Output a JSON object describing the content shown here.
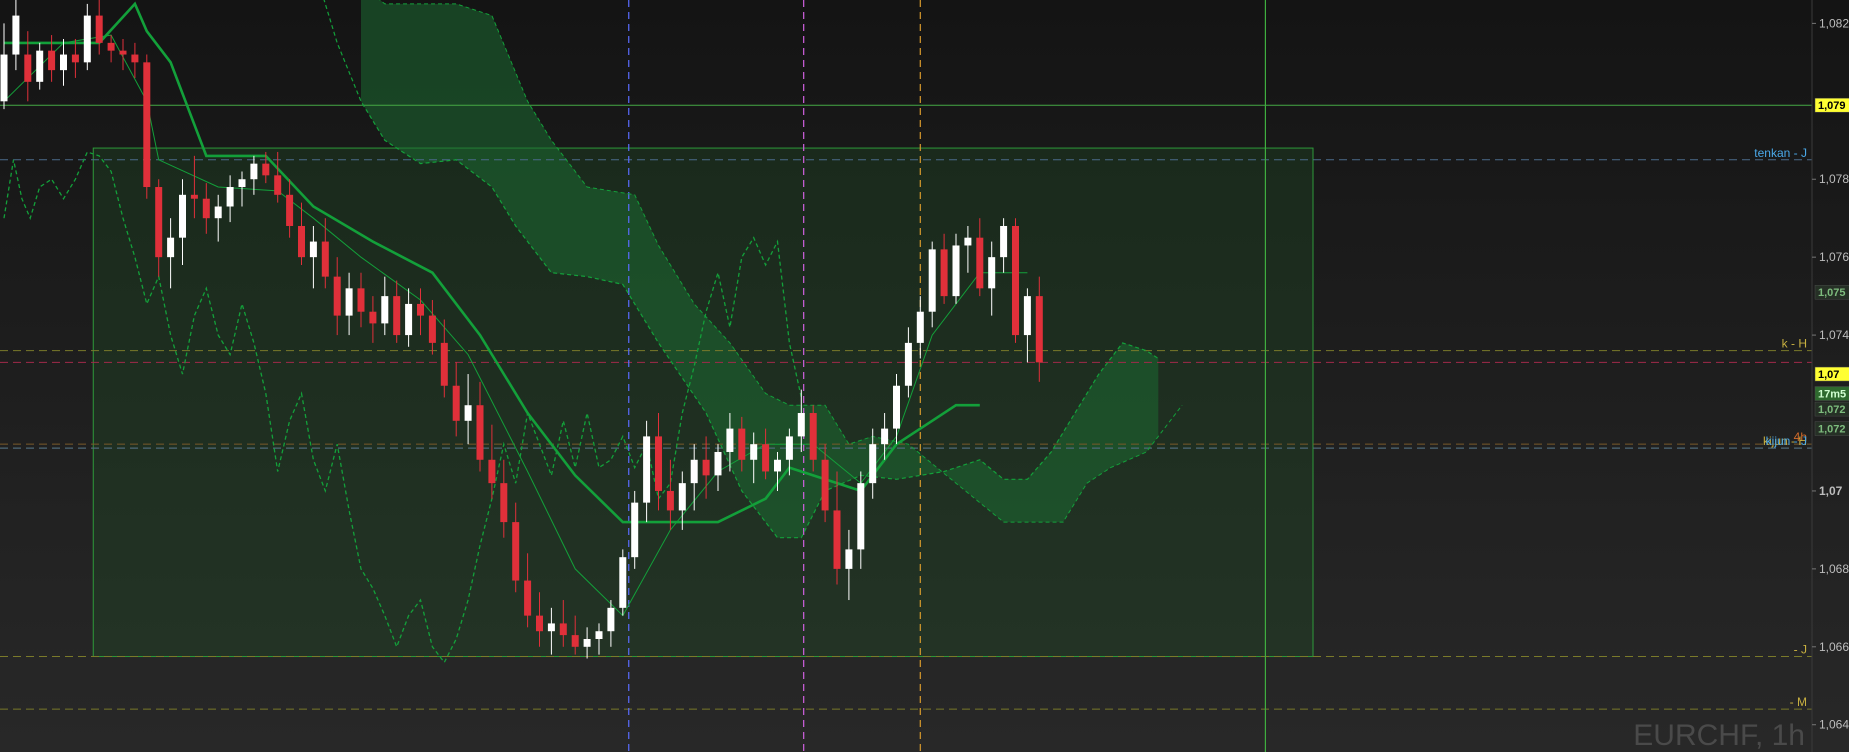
{
  "chart_data": {
    "type": "candlestick",
    "symbol": "EURCHF, 1h",
    "colors": {
      "background_top": "#161616",
      "background_bottom": "#262626",
      "up": "#ffffff",
      "down": "#e0303a",
      "ichimoku": "#13a03a",
      "kumo_fill": "#1c6a32",
      "range_box_fill": "#1f4d26",
      "range_box_stroke": "#2e9a3a",
      "vline_blue": "#5a6cff",
      "vline_magenta": "#d060e0",
      "vline_orange": "#d79a2c",
      "vline_green": "#3fae3f"
    },
    "y_axis": {
      "range": [
        1.0633,
        1.0826
      ],
      "ticks": [
        {
          "value": 1.082,
          "label": "1,082"
        },
        {
          "value": 1.078,
          "label": "1,078"
        },
        {
          "value": 1.076,
          "label": "1,076"
        },
        {
          "value": 1.074,
          "label": "1,074"
        },
        {
          "value": 1.07,
          "label": "1,07"
        },
        {
          "value": 1.068,
          "label": "1,068"
        },
        {
          "value": 1.066,
          "label": "1,066"
        },
        {
          "value": 1.064,
          "label": "1,064"
        }
      ],
      "price_tags": [
        {
          "value": 1.0799,
          "label": "1,079",
          "bg": "#ffff33",
          "fg": "#000000"
        },
        {
          "value": 1.073,
          "label": "1,07",
          "bg": "#ffff33",
          "fg": "#000000"
        },
        {
          "value": 1.0725,
          "label": "17m5",
          "bg": "#2e6a2e",
          "fg": "#d0ffd0"
        },
        {
          "value": 1.0751,
          "label": "1,075",
          "bg": "#263026",
          "fg": "#7dbb7d"
        },
        {
          "value": 1.0721,
          "label": "1,072",
          "bg": "#263026",
          "fg": "#7dbb7d"
        },
        {
          "value": 1.0716,
          "label": "1,072",
          "bg": "#263026",
          "fg": "#7dbb7d"
        }
      ]
    },
    "horizontal_lines": [
      {
        "value": 1.0799,
        "color": "#45a845",
        "style": "solid",
        "label": ""
      },
      {
        "value": 1.0785,
        "color": "#4a6a8a",
        "style": "dashed",
        "label": "tenkan - J",
        "label_color": "#4aa8e8"
      },
      {
        "value": 1.0736,
        "color": "#7a7a2a",
        "style": "dashed",
        "label": "k - H",
        "label_color": "#c8b040"
      },
      {
        "value": 1.0733,
        "color": "#a02a4a",
        "style": "dashed",
        "label": ""
      },
      {
        "value": 1.0712,
        "color": "#7a5a2a",
        "style": "dashed",
        "label": "4h",
        "label_color": "#d06a2a"
      },
      {
        "value": 1.0711,
        "color": "#7a7a2a",
        "style": "dashed",
        "label": "kijun - H",
        "label_color": "#c8b040"
      },
      {
        "value": 1.0711,
        "color": "#4a6a8a",
        "style": "dashed",
        "label": "kijun - J",
        "label_color": "#4aa8e8"
      },
      {
        "value": 1.06575,
        "color": "#7a7a2a",
        "style": "dashed",
        "label": "- J",
        "label_color": "#c8b040"
      },
      {
        "value": 1.0644,
        "color": "#7a7a2a",
        "style": "dashed",
        "label": "- M",
        "label_color": "#c8b040"
      }
    ],
    "range_box": {
      "x_start": 7.5,
      "x_end": 110.0,
      "y_top": 1.0788,
      "y_bottom": 1.06575
    },
    "vertical_lines": [
      {
        "x": 52.5,
        "color_key": "vline_blue"
      },
      {
        "x": 67.2,
        "color_key": "vline_magenta"
      },
      {
        "x": 77.0,
        "color_key": "vline_orange"
      },
      {
        "x": 106.0,
        "color_key": "vline_green"
      }
    ],
    "candles": [
      [
        1.08,
        1.082,
        1.0798,
        1.0812
      ],
      [
        1.0812,
        1.0826,
        1.0808,
        1.0822
      ],
      [
        1.0812,
        1.0818,
        1.08,
        1.0805
      ],
      [
        1.0805,
        1.0815,
        1.0803,
        1.0813
      ],
      [
        1.0813,
        1.0817,
        1.0805,
        1.0808
      ],
      [
        1.0808,
        1.0816,
        1.0804,
        1.0812
      ],
      [
        1.0812,
        1.0816,
        1.0806,
        1.081
      ],
      [
        1.081,
        1.0825,
        1.0808,
        1.0822
      ],
      [
        1.0822,
        1.0826,
        1.0812,
        1.0815
      ],
      [
        1.0815,
        1.0817,
        1.081,
        1.0813
      ],
      [
        1.0813,
        1.0816,
        1.0808,
        1.0812
      ],
      [
        1.0812,
        1.0815,
        1.0806,
        1.081
      ],
      [
        1.081,
        1.0812,
        1.0775,
        1.0778
      ],
      [
        1.0778,
        1.078,
        1.0755,
        1.076
      ],
      [
        1.076,
        1.077,
        1.0752,
        1.0765
      ],
      [
        1.0765,
        1.078,
        1.0758,
        1.0776
      ],
      [
        1.0776,
        1.0786,
        1.077,
        1.0775
      ],
      [
        1.0775,
        1.0779,
        1.0766,
        1.077
      ],
      [
        1.077,
        1.0776,
        1.0764,
        1.0773
      ],
      [
        1.0773,
        1.0781,
        1.0769,
        1.0778
      ],
      [
        1.0778,
        1.0782,
        1.0773,
        1.078
      ],
      [
        1.078,
        1.0786,
        1.0776,
        1.0784
      ],
      [
        1.0784,
        1.0787,
        1.0779,
        1.0781
      ],
      [
        1.0781,
        1.0787,
        1.0774,
        1.0776
      ],
      [
        1.0776,
        1.078,
        1.0765,
        1.0768
      ],
      [
        1.0768,
        1.0774,
        1.0758,
        1.076
      ],
      [
        1.076,
        1.0768,
        1.0752,
        1.0764
      ],
      [
        1.0764,
        1.077,
        1.0752,
        1.0755
      ],
      [
        1.0755,
        1.076,
        1.074,
        1.0745
      ],
      [
        1.0745,
        1.0756,
        1.074,
        1.0752
      ],
      [
        1.0752,
        1.0756,
        1.0742,
        1.0746
      ],
      [
        1.0746,
        1.075,
        1.0738,
        1.0743
      ],
      [
        1.0743,
        1.0755,
        1.074,
        1.075
      ],
      [
        1.075,
        1.0754,
        1.0738,
        1.074
      ],
      [
        1.074,
        1.0752,
        1.0737,
        1.0748
      ],
      [
        1.0748,
        1.0752,
        1.074,
        1.0745
      ],
      [
        1.0745,
        1.0749,
        1.0735,
        1.0738
      ],
      [
        1.0738,
        1.0744,
        1.0724,
        1.0727
      ],
      [
        1.0727,
        1.0733,
        1.0714,
        1.0718
      ],
      [
        1.0718,
        1.073,
        1.0712,
        1.0722
      ],
      [
        1.0722,
        1.0728,
        1.0705,
        1.0708
      ],
      [
        1.0708,
        1.0717,
        1.0698,
        1.0702
      ],
      [
        1.0702,
        1.0708,
        1.0688,
        1.0692
      ],
      [
        1.0692,
        1.0697,
        1.0674,
        1.0677
      ],
      [
        1.0677,
        1.0684,
        1.0665,
        1.0668
      ],
      [
        1.0668,
        1.0674,
        1.066,
        1.0664
      ],
      [
        1.0664,
        1.067,
        1.0658,
        1.0666
      ],
      [
        1.0666,
        1.0672,
        1.066,
        1.0663
      ],
      [
        1.0663,
        1.0668,
        1.0658,
        1.066
      ],
      [
        1.066,
        1.0665,
        1.0657,
        1.0662
      ],
      [
        1.0662,
        1.0666,
        1.0658,
        1.0664
      ],
      [
        1.0664,
        1.0672,
        1.066,
        1.067
      ],
      [
        1.067,
        1.0685,
        1.0668,
        1.0683
      ],
      [
        1.0683,
        1.07,
        1.068,
        1.0697
      ],
      [
        1.0697,
        1.0718,
        1.0692,
        1.0714
      ],
      [
        1.0714,
        1.072,
        1.0695,
        1.07
      ],
      [
        1.07,
        1.0708,
        1.069,
        1.0695
      ],
      [
        1.0695,
        1.0705,
        1.069,
        1.0702
      ],
      [
        1.0702,
        1.0712,
        1.0695,
        1.0708
      ],
      [
        1.0708,
        1.0714,
        1.0698,
        1.0704
      ],
      [
        1.0704,
        1.0712,
        1.07,
        1.071
      ],
      [
        1.071,
        1.072,
        1.0705,
        1.0716
      ],
      [
        1.0716,
        1.0719,
        1.0705,
        1.0708
      ],
      [
        1.0708,
        1.0715,
        1.0702,
        1.0712
      ],
      [
        1.0712,
        1.0716,
        1.0703,
        1.0705
      ],
      [
        1.0705,
        1.071,
        1.07,
        1.0708
      ],
      [
        1.0708,
        1.0716,
        1.0704,
        1.0714
      ],
      [
        1.0714,
        1.0726,
        1.071,
        1.072
      ],
      [
        1.072,
        1.0722,
        1.0705,
        1.0708
      ],
      [
        1.0708,
        1.0712,
        1.0692,
        1.0695
      ],
      [
        1.0695,
        1.0705,
        1.0676,
        1.068
      ],
      [
        1.068,
        1.069,
        1.0672,
        1.0685
      ],
      [
        1.0685,
        1.0705,
        1.068,
        1.0702
      ],
      [
        1.0702,
        1.0716,
        1.0698,
        1.0712
      ],
      [
        1.0712,
        1.072,
        1.0708,
        1.0716
      ],
      [
        1.0716,
        1.073,
        1.0712,
        1.0727
      ],
      [
        1.0727,
        1.0742,
        1.0724,
        1.0738
      ],
      [
        1.0738,
        1.075,
        1.0734,
        1.0746
      ],
      [
        1.0746,
        1.0764,
        1.0742,
        1.0762
      ],
      [
        1.0762,
        1.0766,
        1.0748,
        1.075
      ],
      [
        1.075,
        1.0766,
        1.0748,
        1.0763
      ],
      [
        1.0763,
        1.0768,
        1.0756,
        1.0765
      ],
      [
        1.0765,
        1.077,
        1.075,
        1.0752
      ],
      [
        1.0752,
        1.0764,
        1.0745,
        1.076
      ],
      [
        1.076,
        1.077,
        1.0756,
        1.0768
      ],
      [
        1.0768,
        1.077,
        1.0738,
        1.074
      ],
      [
        1.074,
        1.0752,
        1.0733,
        1.075
      ],
      [
        1.075,
        1.0755,
        1.0728,
        1.0733
      ]
    ],
    "tenkan": [
      [
        0,
        1.08
      ],
      [
        5,
        1.0815
      ],
      [
        9,
        1.0817
      ],
      [
        12,
        1.08
      ],
      [
        13,
        1.0785
      ],
      [
        18,
        1.0778
      ],
      [
        23,
        1.0777
      ],
      [
        26,
        1.077
      ],
      [
        30,
        1.076
      ],
      [
        35,
        1.0749
      ],
      [
        39,
        1.0735
      ],
      [
        44,
        1.0705
      ],
      [
        48,
        1.068
      ],
      [
        52,
        1.0668
      ],
      [
        56,
        1.069
      ],
      [
        60,
        1.0705
      ],
      [
        64,
        1.0712
      ],
      [
        68,
        1.0712
      ],
      [
        72,
        1.0702
      ],
      [
        75,
        1.0714
      ],
      [
        78,
        1.074
      ],
      [
        82,
        1.0756
      ],
      [
        86,
        1.0756
      ]
    ],
    "kijun": [
      [
        0,
        1.0815
      ],
      [
        4,
        1.0815
      ],
      [
        8,
        1.0815
      ],
      [
        11,
        1.0825
      ],
      [
        12,
        1.0818
      ],
      [
        14,
        1.081
      ],
      [
        17,
        1.0786
      ],
      [
        22,
        1.0786
      ],
      [
        26,
        1.0773
      ],
      [
        31,
        1.0764
      ],
      [
        36,
        1.0756
      ],
      [
        40,
        1.074
      ],
      [
        44,
        1.072
      ],
      [
        48,
        1.0704
      ],
      [
        52,
        1.0692
      ],
      [
        56,
        1.0692
      ],
      [
        60,
        1.0692
      ],
      [
        64,
        1.0698
      ],
      [
        66,
        1.0706
      ],
      [
        68,
        1.0704
      ],
      [
        72,
        1.07
      ],
      [
        75,
        1.0712
      ],
      [
        78,
        1.0718
      ],
      [
        80,
        1.0722
      ],
      [
        82,
        1.0722
      ]
    ],
    "senkou_a": [
      [
        30,
        1.083
      ],
      [
        32,
        1.0825
      ],
      [
        38,
        1.0825
      ],
      [
        41,
        1.0822
      ],
      [
        44,
        1.08
      ],
      [
        46,
        1.079
      ],
      [
        49,
        1.0778
      ],
      [
        53,
        1.0776
      ],
      [
        55,
        1.0763
      ],
      [
        58,
        1.0748
      ],
      [
        61,
        1.0738
      ],
      [
        64,
        1.0725
      ],
      [
        66,
        1.0722
      ],
      [
        69,
        1.0722
      ],
      [
        71,
        1.0712
      ],
      [
        73,
        1.0714
      ],
      [
        76,
        1.0712
      ],
      [
        80,
        1.0702
      ],
      [
        84,
        1.0692
      ],
      [
        87,
        1.0692
      ],
      [
        89,
        1.0692
      ],
      [
        91,
        1.0702
      ],
      [
        93,
        1.0706
      ],
      [
        96,
        1.071
      ],
      [
        98,
        1.0718
      ],
      [
        99,
        1.0722
      ]
    ],
    "senkou_b": [
      [
        26,
        1.0835
      ],
      [
        28,
        1.0815
      ],
      [
        30,
        1.08
      ],
      [
        32,
        1.079
      ],
      [
        35,
        1.0784
      ],
      [
        38,
        1.0785
      ],
      [
        41,
        1.0778
      ],
      [
        43,
        1.0768
      ],
      [
        46,
        1.0756
      ],
      [
        49,
        1.0755
      ],
      [
        52,
        1.0753
      ],
      [
        55,
        1.0738
      ],
      [
        59,
        1.072
      ],
      [
        62,
        1.07
      ],
      [
        65,
        1.0688
      ],
      [
        67,
        1.0688
      ],
      [
        69,
        1.07
      ],
      [
        72,
        1.0704
      ],
      [
        75,
        1.0703
      ],
      [
        79,
        1.0705
      ],
      [
        82,
        1.0708
      ],
      [
        84,
        1.0703
      ],
      [
        86,
        1.0703
      ],
      [
        88,
        1.071
      ],
      [
        90,
        1.072
      ],
      [
        92,
        1.073
      ],
      [
        94,
        1.0738
      ],
      [
        96,
        1.0736
      ],
      [
        97,
        1.0734
      ]
    ],
    "chikou": [
      [
        0,
        1.077
      ],
      [
        0.8,
        1.0785
      ],
      [
        1.5,
        1.0775
      ],
      [
        2.2,
        1.077
      ],
      [
        3,
        1.0778
      ],
      [
        4,
        1.078
      ],
      [
        5,
        1.0775
      ],
      [
        6,
        1.078
      ],
      [
        7,
        1.0787
      ],
      [
        8,
        1.0786
      ],
      [
        9,
        1.0782
      ],
      [
        10,
        1.077
      ],
      [
        11,
        1.076
      ],
      [
        12,
        1.0748
      ],
      [
        13,
        1.0755
      ],
      [
        14,
        1.074
      ],
      [
        15,
        1.073
      ],
      [
        16,
        1.0745
      ],
      [
        17,
        1.0752
      ],
      [
        18,
        1.074
      ],
      [
        19,
        1.0735
      ],
      [
        20,
        1.0748
      ],
      [
        21,
        1.0738
      ],
      [
        22,
        1.0725
      ],
      [
        23,
        1.0705
      ],
      [
        24,
        1.0718
      ],
      [
        25,
        1.0725
      ],
      [
        26,
        1.0708
      ],
      [
        27,
        1.07
      ],
      [
        28,
        1.0712
      ],
      [
        29,
        1.0695
      ],
      [
        30,
        1.068
      ],
      [
        31,
        1.0675
      ],
      [
        32,
        1.0668
      ],
      [
        33,
        1.066
      ],
      [
        34,
        1.0668
      ],
      [
        35,
        1.0672
      ],
      [
        36,
        1.066
      ],
      [
        37,
        1.0656
      ],
      [
        38,
        1.0662
      ],
      [
        39,
        1.0672
      ],
      [
        40,
        1.0686
      ],
      [
        41,
        1.0698
      ],
      [
        42,
        1.0712
      ],
      [
        43,
        1.0702
      ],
      [
        44,
        1.072
      ],
      [
        45,
        1.0712
      ],
      [
        46,
        1.0704
      ],
      [
        47,
        1.0718
      ],
      [
        48,
        1.0706
      ],
      [
        49,
        1.072
      ],
      [
        50,
        1.0706
      ],
      [
        51,
        1.0708
      ],
      [
        52,
        1.0714
      ],
      [
        53,
        1.0706
      ],
      [
        54,
        1.0712
      ],
      [
        55,
        1.0698
      ],
      [
        56,
        1.0702
      ],
      [
        57,
        1.072
      ],
      [
        58,
        1.0732
      ],
      [
        59,
        1.0746
      ],
      [
        60,
        1.0756
      ],
      [
        61,
        1.0742
      ],
      [
        62,
        1.076
      ],
      [
        63,
        1.0765
      ],
      [
        64,
        1.0758
      ],
      [
        65,
        1.0764
      ],
      [
        66,
        1.0738
      ],
      [
        67,
        1.0724
      ]
    ]
  }
}
